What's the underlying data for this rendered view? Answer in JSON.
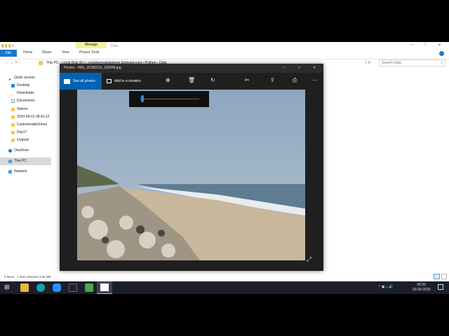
{
  "explorer": {
    "ribbon": {
      "context_group": "Manage",
      "context_tab": "Picture Tools",
      "inactive_tab": "Data",
      "tabs": [
        "File",
        "Home",
        "Share",
        "View"
      ]
    },
    "breadcrumb": [
      "This PC",
      "Local Disk (E:)",
      "coverksmodelsphere.blogspot.com",
      "Python",
      "Data"
    ],
    "search_placeholder": "Search Data",
    "nav": [
      "Quick access",
      "Desktop",
      "Downloads",
      "Documents",
      "Videos",
      "2020-09-01 08.43.22",
      "CustomizableSimul",
      "Day17",
      "Outputs",
      "OneDrive",
      "This PC",
      "Network"
    ],
    "status": {
      "items": "5 items",
      "selected": "1 item selected  3.30 MB"
    }
  },
  "photos": {
    "title": "Photos - IMG_20180116_130048.jpg",
    "see_all": "See all photos",
    "add_creation": "Add to a creation",
    "zoom_level": 0.05
  },
  "taskbar": {
    "time": "08:26",
    "date": "03-09-2020"
  }
}
